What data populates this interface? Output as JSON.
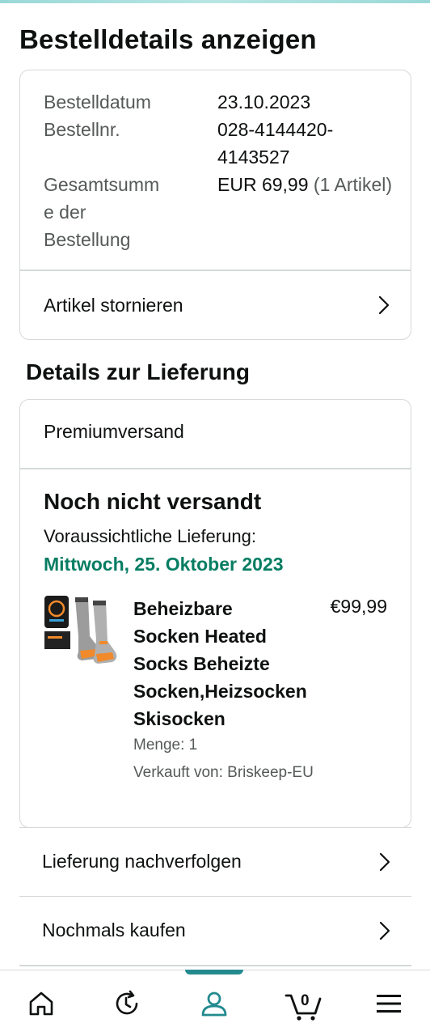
{
  "page": {
    "title": "Bestelldetails anzeigen"
  },
  "summary": {
    "order_date_label": "Bestelldatum",
    "order_date_value": "23.10.2023",
    "order_no_label": "Bestellnr.",
    "order_no_value_line1": "028-4144420-",
    "order_no_value_line2": "4143527",
    "total_label_line1": "Gesamtsumm",
    "total_label_line2": "e der",
    "total_label_line3": "Bestellung",
    "total_value": "EUR 69,99",
    "total_items": "(1 Artikel)",
    "cancel_label": "Artikel stornieren"
  },
  "delivery": {
    "section_title": "Details zur Lieferung",
    "shipping_type": "Premiumversand",
    "status": "Noch nicht versandt",
    "eta_label": "Voraussichtliche Lieferung:",
    "eta_date": "Mittwoch, 25. Oktober 2023",
    "accent_color": "#067d62",
    "item": {
      "name_line1": "Beheizbare",
      "name_line2": "Socken Heated",
      "name_line3": "Socks Beheizte",
      "name_line4": "Socken,Heizsocken",
      "name_line5": "Skisocken",
      "price": "€99,99",
      "quantity": "Menge: 1",
      "seller": "Verkauft von: Briskeep-EU"
    }
  },
  "actions": {
    "track_label": "Lieferung nachverfolgen",
    "buy_again_label": "Nochmals kaufen"
  },
  "bottom_nav": {
    "items": [
      "home-icon",
      "history-icon",
      "account-icon",
      "cart-icon",
      "menu-icon"
    ],
    "active": "account-icon",
    "cart_count": "0",
    "active_color": "#238a8f"
  }
}
